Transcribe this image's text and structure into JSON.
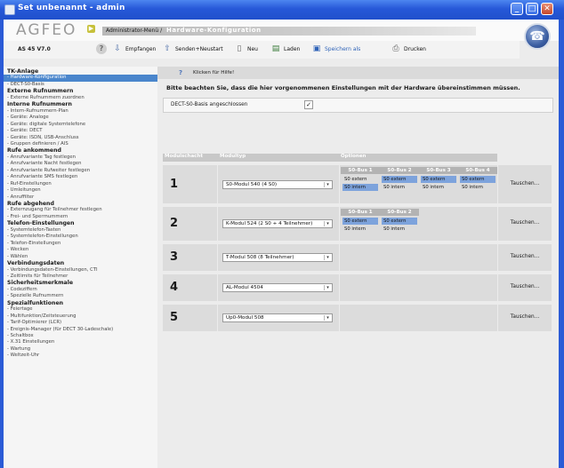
{
  "window": {
    "title": "Set unbenannt - admin",
    "controls": {
      "minimize": "_",
      "maximize": "□",
      "close": "✕"
    }
  },
  "header": {
    "logo": "AGFEO",
    "breadcrumb_prefix": "Administrator-Menü /",
    "breadcrumb_current": "Hardware-Konfiguration"
  },
  "toolbar": {
    "version": "AS 45 V7.0",
    "items": [
      {
        "label": "Empfangen",
        "icon": "receive-icon"
      },
      {
        "label": "Senden+Neustart",
        "icon": "send-restart-icon"
      },
      {
        "label": "Neu",
        "icon": "new-document-icon"
      },
      {
        "label": "Laden",
        "icon": "load-icon"
      },
      {
        "label": "Speichern als",
        "icon": "save-as-icon"
      },
      {
        "label": "Drucken",
        "icon": "print-icon"
      }
    ]
  },
  "nav": [
    {
      "t": "h",
      "label": "TK-Anlage"
    },
    {
      "t": "i",
      "label": "- Hardware-Konfiguration",
      "selected": true
    },
    {
      "t": "i",
      "label": "- DECT-S0-Basis"
    },
    {
      "t": "h",
      "label": "Externe Rufnummern"
    },
    {
      "t": "i",
      "label": "- Externe Rufnummern zuordnen"
    },
    {
      "t": "h",
      "label": "Interne Rufnummern"
    },
    {
      "t": "i",
      "label": "- Intern-Rufnummern-Plan"
    },
    {
      "t": "i",
      "label": "- Geräte: Analoge"
    },
    {
      "t": "i",
      "label": "- Geräte: digitale Systemtelefone"
    },
    {
      "t": "i",
      "label": "- Geräte: DECT"
    },
    {
      "t": "i",
      "label": "- Geräte: ISDN, USB-Anschluss"
    },
    {
      "t": "i",
      "label": "- Gruppen definieren / AIS"
    },
    {
      "t": "h",
      "label": "Rufe ankommend"
    },
    {
      "t": "i",
      "label": "- Anrufvariante Tag festlegen"
    },
    {
      "t": "i",
      "label": "- Anrufvariante Nacht festlegen"
    },
    {
      "t": "i",
      "label": "- Anrufvariante Rufweiter festlegen"
    },
    {
      "t": "i",
      "label": "- Anrufvariante SMS festlegen"
    },
    {
      "t": "i",
      "label": "- Ruf-Einstellungen"
    },
    {
      "t": "i",
      "label": "- Umleitungen"
    },
    {
      "t": "i",
      "label": "- Anruffilter"
    },
    {
      "t": "h",
      "label": "Rufe abgehend"
    },
    {
      "t": "i",
      "label": "- Externzugang für Teilnehmer festlegen"
    },
    {
      "t": "i",
      "label": "- Frei- und Sperrnummern"
    },
    {
      "t": "h",
      "label": "Telefon-Einstellungen"
    },
    {
      "t": "i",
      "label": "- Systemtelefon-Tasten"
    },
    {
      "t": "i",
      "label": "- Systemtelefon-Einstellungen"
    },
    {
      "t": "i",
      "label": "- Telefon-Einstellungen"
    },
    {
      "t": "i",
      "label": "- Wecken"
    },
    {
      "t": "i",
      "label": "- Wählen"
    },
    {
      "t": "h",
      "label": "Verbindungsdaten"
    },
    {
      "t": "i",
      "label": "- Verbindungsdaten-Einstellungen, CTI"
    },
    {
      "t": "i",
      "label": "- Zeitlimits für Teilnehmer"
    },
    {
      "t": "h",
      "label": "Sicherheitsmerkmale"
    },
    {
      "t": "i",
      "label": "- Codeziffern"
    },
    {
      "t": "i",
      "label": "- Spezielle Rufnummern"
    },
    {
      "t": "h",
      "label": "Spezialfunktionen"
    },
    {
      "t": "i",
      "label": "- Feiertage"
    },
    {
      "t": "i",
      "label": "- Multifunktion/Zeitsteuerung"
    },
    {
      "t": "i",
      "label": "- Tarif-Optimierer (LCR)"
    },
    {
      "t": "i",
      "label": "- Ereignis-Manager (für DECT 30-Ladeschale)"
    },
    {
      "t": "i",
      "label": "- Schaltbox"
    },
    {
      "t": "i",
      "label": "- X.31 Einstellungen"
    },
    {
      "t": "i",
      "label": "- Wartung"
    },
    {
      "t": "i",
      "label": "- Weltzeit-Uhr"
    }
  ],
  "main": {
    "help_icon": "?",
    "help_text": "Klicken für Hilfe!",
    "notice": "Bitte beachten Sie, dass die hier vorgenommenen Einstellungen mit der Hardware übereinstimmen müssen.",
    "dect_label": "DECT-S0-Basis angeschlossen",
    "dect_checked": "✓",
    "headers": {
      "slot": "Modulschacht",
      "type": "Modultyp",
      "options": "Optionen"
    },
    "swap_label": "Tauschen...",
    "rows": [
      {
        "slot": "1",
        "module": "S0-Modul 540 (4 S0)",
        "options": [
          {
            "head": "S0-Bus 1",
            "values": [
              "S0 extern",
              "S0 intern"
            ],
            "selected": 1
          },
          {
            "head": "S0-Bus 2",
            "values": [
              "S0 extern",
              "S0 intern"
            ],
            "selected": 0
          },
          {
            "head": "S0-Bus 3",
            "values": [
              "S0 extern",
              "S0 intern"
            ],
            "selected": 0
          },
          {
            "head": "S0-Bus 4",
            "values": [
              "S0 extern",
              "S0 intern"
            ],
            "selected": 0
          }
        ]
      },
      {
        "slot": "2",
        "module": "K-Modul 524 (2 S0 + 4 Teilnehmer)",
        "options": [
          {
            "head": "S0-Bus 1",
            "values": [
              "S0 extern",
              "S0 intern"
            ],
            "selected": 0
          },
          {
            "head": "S0-Bus 2",
            "values": [
              "S0 extern",
              "S0 intern"
            ],
            "selected": 0
          }
        ]
      },
      {
        "slot": "3",
        "module": "T-Modul 508 (8 Teilnehmer)",
        "options": []
      },
      {
        "slot": "4",
        "module": "AL-Modul 4504",
        "options": []
      },
      {
        "slot": "5",
        "module": "Up0-Modul 508",
        "options": []
      }
    ]
  }
}
